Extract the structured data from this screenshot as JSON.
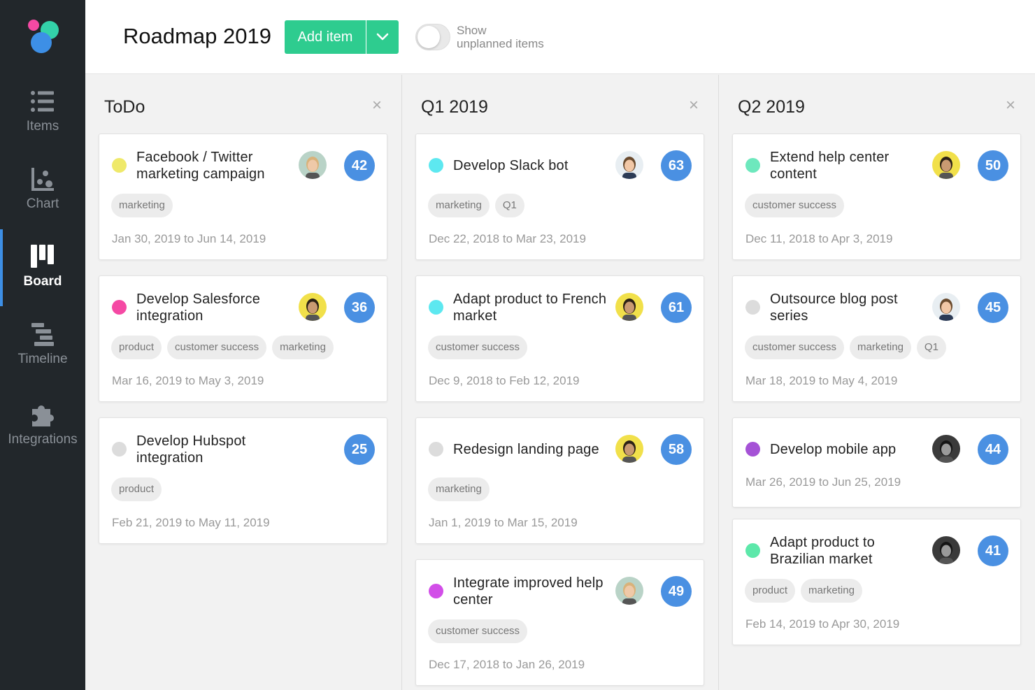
{
  "app": {
    "title": "Roadmap 2019",
    "add_button_label": "Add item",
    "toggle_label_line1": "Show",
    "toggle_label_line2": "unplanned items"
  },
  "nav": [
    {
      "label": "Items",
      "icon": "list-icon",
      "active": false
    },
    {
      "label": "Chart",
      "icon": "chart-icon",
      "active": false
    },
    {
      "label": "Board",
      "icon": "board-icon",
      "active": true
    },
    {
      "label": "Timeline",
      "icon": "timeline-icon",
      "active": false
    },
    {
      "label": "Integrations",
      "icon": "puzzle-icon",
      "active": false
    }
  ],
  "colors": {
    "accent_green": "#2ecc8f",
    "active_blue": "#3d8fe6",
    "sidebar_bg": "#22272b",
    "score_bubble": "#4a90e2"
  },
  "columns": [
    {
      "title": "ToDo",
      "cards": [
        {
          "title": "Facebook / Twitter marketing campaign",
          "dot": "#efe96a",
          "avatar": "woman-blonde",
          "score": "42",
          "tags": [
            "marketing"
          ],
          "dates": "Jan 30, 2019 to Jun 14, 2019"
        },
        {
          "title": "Develop Salesforce integration",
          "dot": "#f549a4",
          "avatar": "man-yellow",
          "score": "36",
          "tags": [
            "product",
            "customer success",
            "marketing"
          ],
          "dates": "Mar 16, 2019 to May 3, 2019"
        },
        {
          "title": "Develop Hubspot integration",
          "dot": "#dcdcdc",
          "avatar": "",
          "score": "25",
          "tags": [
            "product"
          ],
          "dates": "Feb 21, 2019 to May 11, 2019"
        }
      ]
    },
    {
      "title": "Q1 2019",
      "cards": [
        {
          "title": "Develop Slack bot",
          "dot": "#5de8f0",
          "avatar": "man-suit",
          "score": "63",
          "tags": [
            "marketing",
            "Q1"
          ],
          "dates": "Dec 22, 2018 to Mar 23, 2019"
        },
        {
          "title": "Adapt product to French market",
          "dot": "#5de8f0",
          "avatar": "man-yellow",
          "score": "61",
          "tags": [
            "customer success"
          ],
          "dates": "Dec 9, 2018 to Feb 12, 2019"
        },
        {
          "title": "Redesign landing page",
          "dot": "#dcdcdc",
          "avatar": "man-yellow",
          "score": "58",
          "tags": [
            "marketing"
          ],
          "dates": "Jan 1, 2019 to Mar 15, 2019"
        },
        {
          "title": "Integrate improved help center",
          "dot": "#d24ee8",
          "avatar": "woman-blonde",
          "score": "49",
          "tags": [
            "customer success"
          ],
          "dates": "Dec 17, 2018 to Jan 26, 2019"
        }
      ]
    },
    {
      "title": "Q2 2019",
      "cards": [
        {
          "title": "Extend help center content",
          "dot": "#6de8bd",
          "avatar": "man-yellow",
          "score": "50",
          "tags": [
            "customer success"
          ],
          "dates": "Dec 11, 2018 to Apr 3, 2019"
        },
        {
          "title": "Outsource blog post series",
          "dot": "#dcdcdc",
          "avatar": "man-suit",
          "score": "45",
          "tags": [
            "customer success",
            "marketing",
            "Q1"
          ],
          "dates": "Mar 18, 2019 to May 4, 2019"
        },
        {
          "title": "Develop mobile app",
          "dot": "#a552d6",
          "avatar": "man-dark",
          "score": "44",
          "tags": [],
          "dates": "Mar 26, 2019 to Jun 25, 2019"
        },
        {
          "title": "Adapt product to Brazilian market",
          "dot": "#5de8aa",
          "avatar": "man-dark",
          "score": "41",
          "tags": [
            "product",
            "marketing"
          ],
          "dates": "Feb 14, 2019 to Apr 30, 2019"
        }
      ]
    }
  ]
}
